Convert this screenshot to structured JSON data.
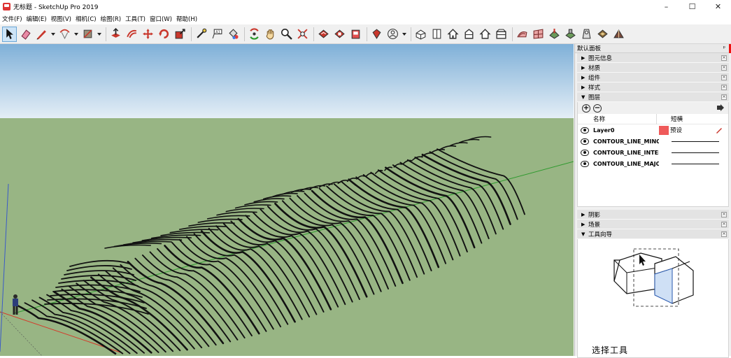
{
  "window": {
    "title": "无标题 - SketchUp Pro 2019",
    "controls": [
      "–",
      "☐",
      "✕"
    ]
  },
  "menu": {
    "items": [
      "文件(F)",
      "编辑(E)",
      "视图(V)",
      "相机(C)",
      "绘图(R)",
      "工具(T)",
      "窗口(W)",
      "帮助(H)"
    ]
  },
  "toolbar": {
    "tools": [
      "select-icon",
      "eraser-icon",
      "pencil-line-icon",
      "arc-icon",
      "shape-icon",
      "push-pull-icon",
      "offset-icon",
      "move-icon",
      "rotate-icon",
      "scale-icon",
      "tape-measure-icon",
      "text-icon",
      "paint-bucket-icon",
      "orbit-icon",
      "pan-icon",
      "zoom-icon",
      "zoom-extents-icon",
      "warehouse-icon",
      "extension-warehouse-icon",
      "layout-icon",
      "ruby-icon",
      "account-icon",
      "iso-view-icon",
      "top-view-icon",
      "front-view-icon",
      "right-view-icon",
      "back-view-icon",
      "left-view-icon",
      "sandbox-contours-icon",
      "sandbox-scratch-icon",
      "smoove-icon",
      "stamp-icon",
      "drape-icon",
      "add-detail-icon",
      "flip-edge-icon"
    ]
  },
  "panel": {
    "title": "默认面板",
    "trays_top": [
      {
        "label": "图元信息",
        "expanded": false
      },
      {
        "label": "材质",
        "expanded": false
      },
      {
        "label": "组件",
        "expanded": false
      },
      {
        "label": "样式",
        "expanded": false
      },
      {
        "label": "图层",
        "expanded": true
      }
    ],
    "layers": {
      "col_name": "名称",
      "col_dashes": "短横",
      "rows": [
        {
          "name": "Layer0",
          "visible": true,
          "color": "#ef5a5a",
          "dashes": "预设"
        },
        {
          "name": "CONTOUR_LINE_MINOF",
          "visible": true,
          "dashes": ""
        },
        {
          "name": "CONTOUR_LINE_INTERI",
          "visible": true,
          "dashes": ""
        },
        {
          "name": "CONTOUR_LINE_MAJOI",
          "visible": true,
          "dashes": ""
        }
      ]
    },
    "trays_bottom": [
      {
        "label": "阴影",
        "expanded": false
      },
      {
        "label": "场景",
        "expanded": false
      },
      {
        "label": "工具向导",
        "expanded": true
      }
    ],
    "guide_title": "选择工具"
  },
  "colors": {
    "sky_top": "#7fb0d8",
    "sky_bottom": "#e4eef6",
    "ground": "#98b584",
    "contour": "#111111",
    "axis_red": "#d43a2a",
    "axis_green": "#2f9a2f",
    "axis_blue": "#3a5ac8"
  }
}
